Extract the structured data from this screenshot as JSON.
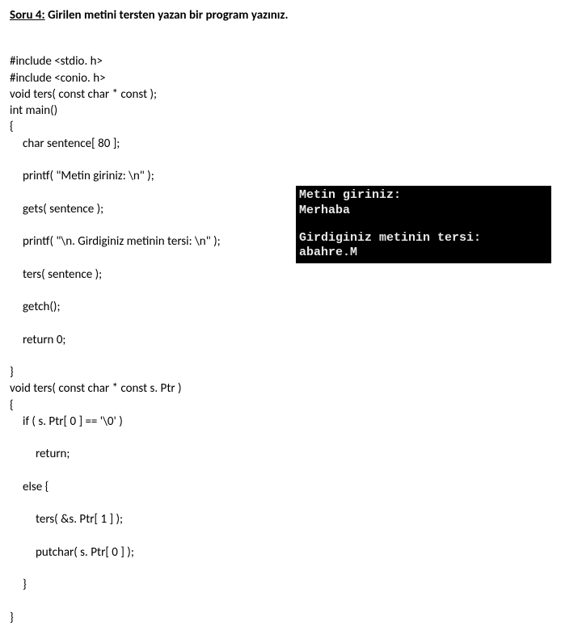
{
  "title": {
    "label": "Soru 4:",
    "text": " Girilen metini tersten yazan bir program yazınız."
  },
  "code": {
    "l1": "#include <stdio. h>",
    "l2": "#include <conio. h>",
    "l3": "void ters( const char * const );",
    "l4": "int main()",
    "l5": "{",
    "l6": "char sentence[ 80 ];",
    "l7": "printf( \"Metin giriniz: \\n\" );",
    "l8": "gets( sentence );",
    "l9": "printf( \"\\n. Girdiginiz metinin tersi: \\n\" );",
    "l10": "ters( sentence );",
    "l11": "getch();",
    "l12": "return 0;",
    "l13": "}",
    "l14": "void ters( const char * const s. Ptr )",
    "l15": "{",
    "l16": "if ( s. Ptr[ 0 ] == '\\0' )",
    "l17": "return;",
    "l18": "else {",
    "l19": "ters( &s. Ptr[ 1 ] );",
    "l20": "putchar( s. Ptr[ 0 ] );",
    "l21": "}",
    "l22": "}"
  },
  "console": {
    "line1": "Metin giriniz:",
    "line2": "Merhaba",
    "line3": "Girdiginiz metinin tersi:",
    "line4": "abahre.M"
  }
}
